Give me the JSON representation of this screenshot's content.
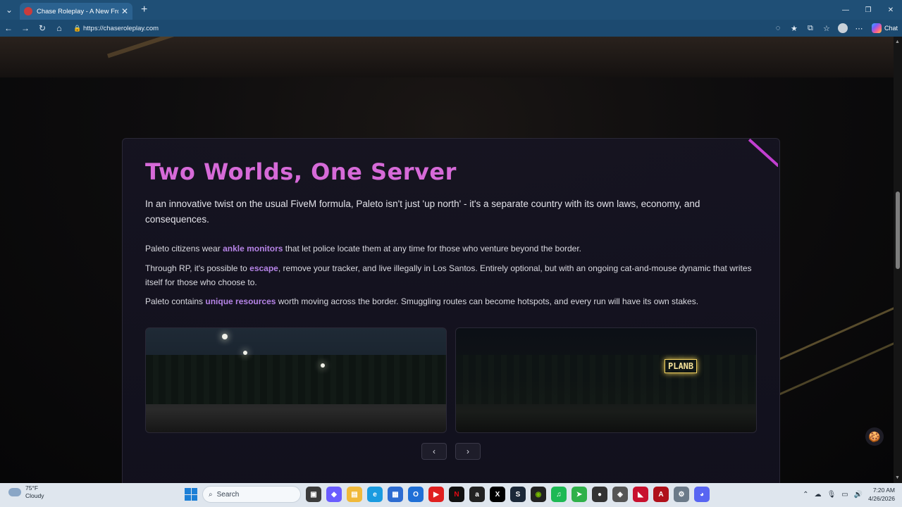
{
  "browser": {
    "tab_title": "Chase Roleplay - A New Frontier f",
    "url": "https://chaseroleplay.com",
    "chat_label": "Chat"
  },
  "section": {
    "title": "Two Worlds, One Server",
    "lead": "In an innovative twist on the usual FiveM formula, Paleto isn't just 'up north' - it's a separate country with its own laws, economy, and consequences.",
    "p1_pre": "Paleto citizens wear ",
    "p1_hl": "ankle monitors",
    "p1_post": " that let police locate them at any time for those who venture beyond the border.",
    "p2_pre": "Through RP, it's possible to ",
    "p2_hl": "escape",
    "p2_post": ", remove your tracker, and live illegally in Los Santos. Entirely optional, but with an ongoing cat-and-mouse dynamic that writes itself for those who choose to.",
    "p3_pre": "Paleto contains ",
    "p3_hl": "unique resources",
    "p3_post": " worth moving across the border. Smuggling routes can become hotspots, and every run will have its own stakes.",
    "image2_sign": "PLANB",
    "prev_icon": "‹",
    "next_icon": "›"
  },
  "taskbar": {
    "temp": "75°F",
    "condition": "Cloudy",
    "search_placeholder": "Search",
    "time": "7:20 AM",
    "date": "4/26/2026"
  },
  "colors": {
    "accent": "#d66ad8",
    "highlight": "#b583e6",
    "titlebar": "#1f4f76"
  }
}
